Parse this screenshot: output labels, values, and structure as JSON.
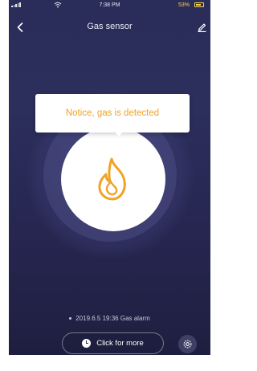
{
  "status_bar": {
    "time": "7:38 PM",
    "battery_percent": "53%",
    "icons": [
      "signal-icon",
      "wifi-icon",
      "battery-icon"
    ]
  },
  "header": {
    "title": "Gas sensor",
    "back_icon": "chevron-left-icon",
    "edit_icon": "pencil-icon"
  },
  "notice": {
    "text": "Notice, gas is detected"
  },
  "sensor": {
    "icon": "flame-icon"
  },
  "alarm_log": {
    "text": "2019.6.5 19:36 Gas alarm"
  },
  "actions": {
    "more_label": "Click for more",
    "more_icon": "clock-icon",
    "settings_icon": "gear-icon"
  },
  "colors": {
    "accent": "#f0a324",
    "background_top": "#2a2d5a",
    "background_bottom": "#1e1f3f"
  }
}
